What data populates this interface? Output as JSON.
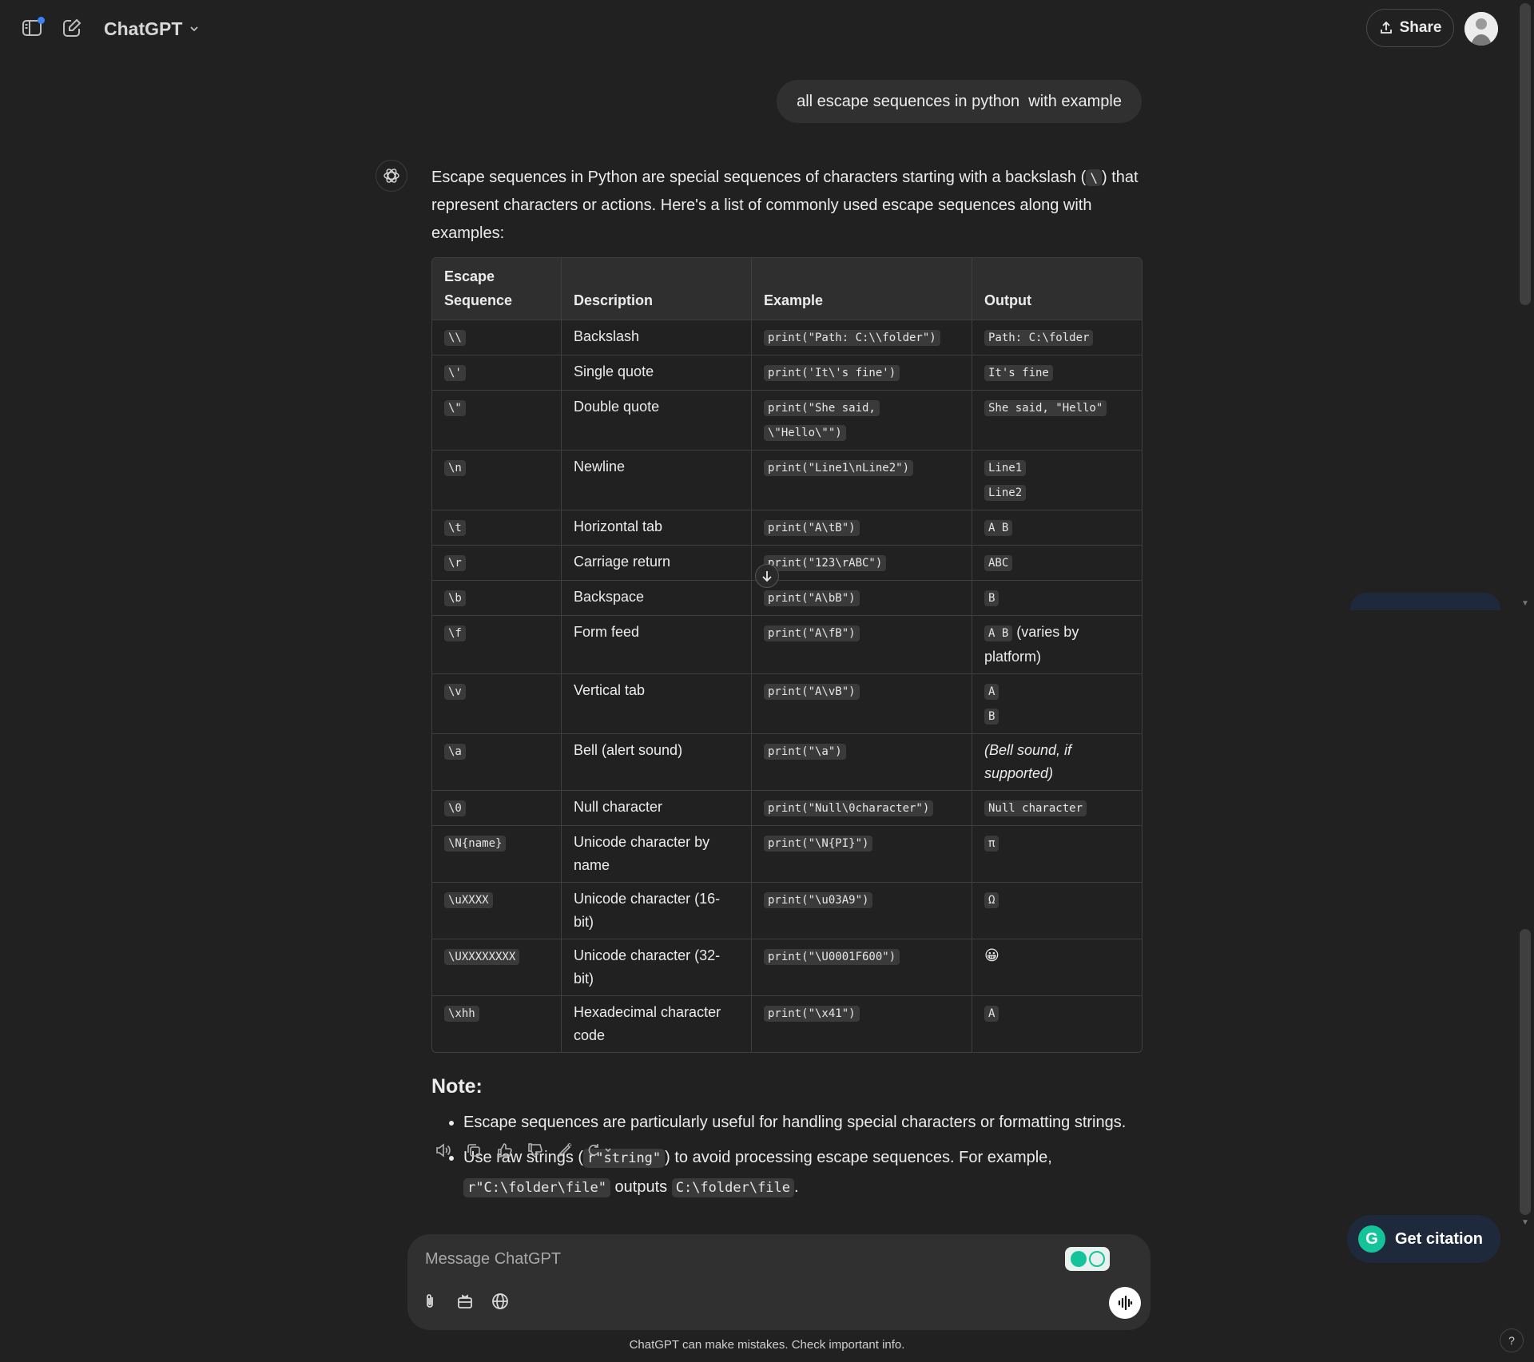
{
  "header": {
    "model_name": "ChatGPT",
    "share_label": "Share"
  },
  "conversation": {
    "user_message": "all escape sequences in python  with example",
    "intro": {
      "before_code": "Escape sequences in Python are special sequences of characters starting with a backslash (",
      "code": "\\",
      "after_code": ") that represent characters or actions. Here's a list of commonly used escape sequences along with examples:"
    },
    "table": {
      "headers": [
        "Escape Sequence",
        "Description",
        "Example",
        "Output"
      ],
      "rows": [
        {
          "seq": "\\\\",
          "desc": "Backslash",
          "example": [
            "print(\"Path: C:\\\\folder\")"
          ],
          "output": [
            {
              "code": "Path: C:\\folder"
            }
          ]
        },
        {
          "seq": "\\'",
          "desc": "Single quote",
          "example": [
            "print('It\\'s fine')"
          ],
          "output": [
            {
              "code": "It's fine"
            }
          ]
        },
        {
          "seq": "\\\"",
          "desc": "Double quote",
          "example": [
            "print(\"She said,",
            "\\\"Hello\\\"\")"
          ],
          "output": [
            {
              "code": "She said, \"Hello\""
            }
          ]
        },
        {
          "seq": "\\n",
          "desc": "Newline",
          "example": [
            "print(\"Line1\\nLine2\")"
          ],
          "output": [
            {
              "code": "Line1"
            },
            {
              "code": "Line2"
            }
          ]
        },
        {
          "seq": "\\t",
          "desc": "Horizontal tab",
          "example": [
            "print(\"A\\tB\")"
          ],
          "output": [
            {
              "code": "A B"
            }
          ]
        },
        {
          "seq": "\\r",
          "desc": "Carriage return",
          "example": [
            "print(\"123\\rABC\")"
          ],
          "output": [
            {
              "code": "ABC"
            }
          ]
        },
        {
          "seq": "\\b",
          "desc": "Backspace",
          "example": [
            "print(\"A\\bB\")"
          ],
          "output": [
            {
              "code": "B"
            }
          ]
        },
        {
          "seq": "\\f",
          "desc": "Form feed",
          "example": [
            "print(\"A\\fB\")"
          ],
          "output": [
            {
              "code": "A B",
              "text": " (varies by platform)"
            }
          ]
        },
        {
          "seq": "\\v",
          "desc": "Vertical tab",
          "example": [
            "print(\"A\\vB\")"
          ],
          "output": [
            {
              "code": "A"
            },
            {
              "code": "B"
            }
          ]
        },
        {
          "seq": "\\a",
          "desc": "Bell (alert sound)",
          "example": [
            "print(\"\\a\")"
          ],
          "output": [
            {
              "italic": "(Bell sound, if supported)"
            }
          ]
        },
        {
          "seq": "\\0",
          "desc": "Null character",
          "example": [
            "print(\"Null\\0character\")"
          ],
          "output": [
            {
              "code": "Null character"
            }
          ]
        },
        {
          "seq": "\\N{name}",
          "desc": "Unicode character by name",
          "example": [
            "print(\"\\N{PI}\")"
          ],
          "output": [
            {
              "code": "π"
            }
          ]
        },
        {
          "seq": "\\uXXXX",
          "desc": "Unicode character (16-bit)",
          "example": [
            "print(\"\\u03A9\")"
          ],
          "output": [
            {
              "code": "Ω"
            }
          ]
        },
        {
          "seq": "\\UXXXXXXXX",
          "desc": "Unicode character (32-bit)",
          "example": [
            "print(\"\\U0001F600\")"
          ],
          "output": [
            {
              "emoji": "😀"
            }
          ]
        },
        {
          "seq": "\\xhh",
          "desc": "Hexadecimal character code",
          "example": [
            "print(\"\\x41\")"
          ],
          "output": [
            {
              "code": "A"
            }
          ]
        }
      ]
    },
    "note": {
      "heading": "Note:",
      "bullet1": "Escape sequences are particularly useful for handling special characters or formatting strings.",
      "bullet2": {
        "t1": "Use raw strings (",
        "c1": "r\"string\"",
        "t2": ") to avoid processing escape sequences. For example, ",
        "c2": "r\"C:\\folder\\file\"",
        "t3": " outputs ",
        "c3": "C:\\folder\\file",
        "t4": "."
      }
    }
  },
  "composer": {
    "placeholder": "Message ChatGPT"
  },
  "footer": {
    "disclaimer": "ChatGPT can make mistakes. Check important info."
  },
  "citation": {
    "label": "Get citation",
    "logo_letter": "G"
  },
  "help_label": "?",
  "colors": {
    "background": "#212121",
    "bubble": "#303030",
    "grammarly_green": "#15c39a",
    "citation_bg": "#1e2a3b"
  }
}
